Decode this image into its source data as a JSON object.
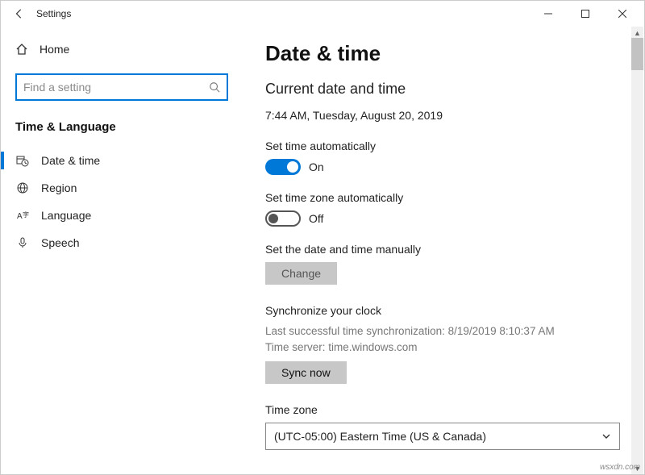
{
  "titlebar": {
    "app_name": "Settings"
  },
  "sidebar": {
    "home_label": "Home",
    "search_placeholder": "Find a setting",
    "category_label": "Time & Language",
    "items": [
      {
        "label": "Date & time"
      },
      {
        "label": "Region"
      },
      {
        "label": "Language"
      },
      {
        "label": "Speech"
      }
    ]
  },
  "main": {
    "heading": "Date & time",
    "current_heading": "Current date and time",
    "current_value": "7:44 AM, Tuesday, August 20, 2019",
    "auto_time": {
      "label": "Set time automatically",
      "state_text": "On"
    },
    "auto_tz": {
      "label": "Set time zone automatically",
      "state_text": "Off"
    },
    "manual": {
      "label": "Set the date and time manually",
      "button": "Change"
    },
    "sync": {
      "heading": "Synchronize your clock",
      "last_sync": "Last successful time synchronization: 8/19/2019 8:10:37 AM",
      "server": "Time server: time.windows.com",
      "button": "Sync now"
    },
    "tz": {
      "label": "Time zone",
      "selected": "(UTC-05:00) Eastern Time (US & Canada)"
    }
  },
  "watermark": "wsxdn.com"
}
